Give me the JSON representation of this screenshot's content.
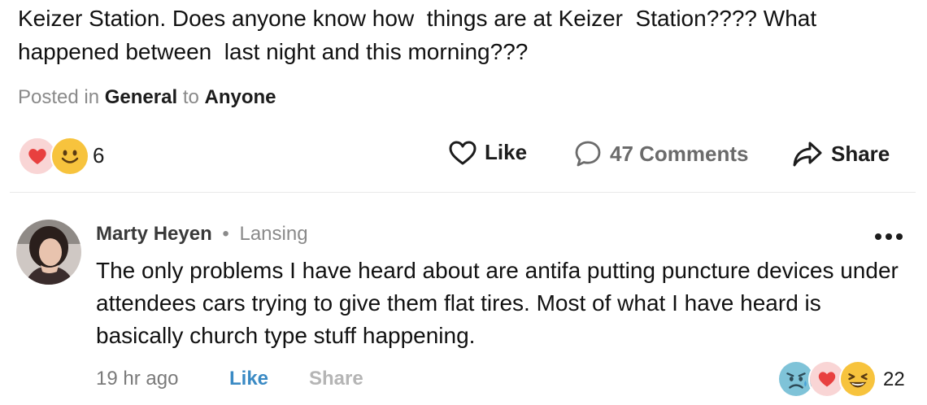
{
  "post": {
    "text": "Keizer Station. Does anyone know how  things are at Keizer  Station???? What\nhappened between  last night and this morning???",
    "posted_in_prefix": "Posted in",
    "category": "General",
    "to_word": "to",
    "audience": "Anyone",
    "reaction_icons": [
      "heart-reaction",
      "smile-reaction"
    ],
    "reaction_count": "6",
    "actions": {
      "like": "Like",
      "comments": "47 Comments",
      "share": "Share"
    }
  },
  "comment": {
    "author": "Marty Heyen",
    "separator": "•",
    "location": "Lansing",
    "text": "The only problems I have heard about are antifa putting puncture devices under attendees cars trying to give them flat tires. Most of what I have heard is basically church type stuff happening.",
    "time": "19 hr ago",
    "like_label": "Like",
    "share_label": "Share",
    "reaction_icons": [
      "sad-reaction",
      "heart-reaction",
      "laugh-reaction"
    ],
    "reaction_count": "22"
  },
  "colors": {
    "link_blue": "#3a8ac4",
    "muted_gray": "#8a8a8a",
    "heart_red": "#e8403f",
    "emoji_yellow": "#f7c33d"
  }
}
